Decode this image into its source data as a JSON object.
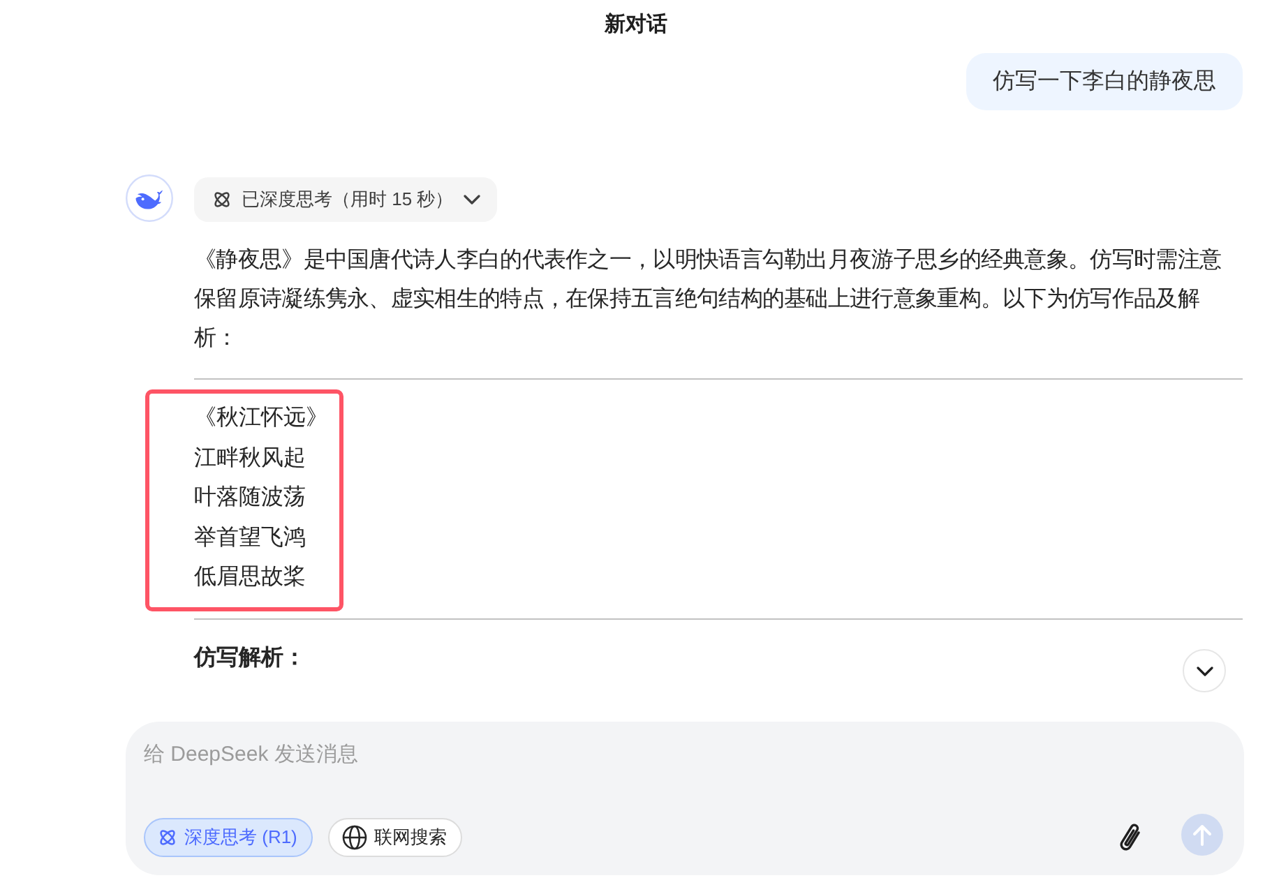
{
  "header": {
    "title": "新对话"
  },
  "messages": [
    {
      "kind": "user",
      "text": "仿写一下李白的静夜思"
    },
    {
      "kind": "assistant",
      "thinking": {
        "label": "已深度思考（用时 15 秒）",
        "expanded": false
      },
      "content": [
        {
          "kind": "paragraph",
          "text": "《静夜思》是中国唐代诗人李白的代表作之一，以明快语言勾勒出月夜游子思乡的经典意象。仿写时需注意保留原诗凝练隽永、虚实相生的特点，在保持五言绝句结构的基础上进行意象重构。以下为仿写作品及解析："
        },
        {
          "kind": "rule"
        },
        {
          "kind": "poem",
          "highlighted": true,
          "lines": [
            "《秋江怀远》",
            "江畔秋风起",
            "叶落随波荡",
            "举首望飞鸿",
            "低眉思故桨"
          ]
        },
        {
          "kind": "rule"
        },
        {
          "kind": "heading",
          "text": "仿写解析："
        }
      ]
    }
  ],
  "composer": {
    "placeholder": "给 DeepSeek 发送消息",
    "toggles": [
      {
        "label": "深度思考 (R1)",
        "selected": true
      },
      {
        "label": "联网搜索",
        "selected": false
      }
    ],
    "send_button": {
      "disabled": true
    }
  }
}
